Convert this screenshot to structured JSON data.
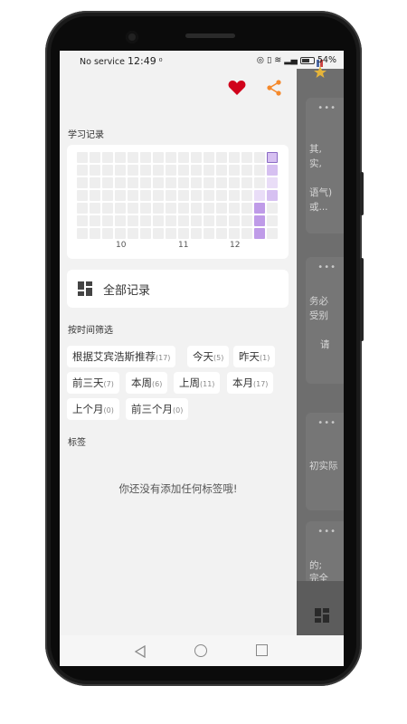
{
  "status_bar": {
    "carrier": "No service",
    "time": "12:49",
    "battery": "54%"
  },
  "drawer": {
    "study_record_title": "学习记录",
    "heatmap": {
      "x_labels": [
        "10",
        "11",
        "12"
      ]
    },
    "all_records_label": "全部记录",
    "filter_title": "按时间筛选",
    "filters": [
      {
        "label": "根据艾宾浩斯推荐",
        "count": "(17)"
      },
      {
        "label": "今天",
        "count": "(5)"
      },
      {
        "label": "昨天",
        "count": "(1)"
      },
      {
        "label": "前三天",
        "count": "(7)"
      },
      {
        "label": "本周",
        "count": "(6)"
      },
      {
        "label": "上周",
        "count": "(11)"
      },
      {
        "label": "本月",
        "count": "(17)"
      },
      {
        "label": "上个月",
        "count": "(0)"
      },
      {
        "label": "前三个月",
        "count": "(0)"
      }
    ],
    "tags_title": "标签",
    "empty_tags_text": "你还没有添加任何标签哦!"
  },
  "background_app": {
    "snippets": [
      "其,",
      "实,",
      "语气)",
      "或...",
      "务必",
      "受别",
      "请",
      "初实际",
      "的;",
      "完全"
    ]
  },
  "colors": {
    "heart": "#d0021b",
    "share": "#f5892b",
    "heat_light": "#e9ddf7",
    "heat_mid": "#d6c0f1",
    "heat_dark": "#bf9be8"
  }
}
